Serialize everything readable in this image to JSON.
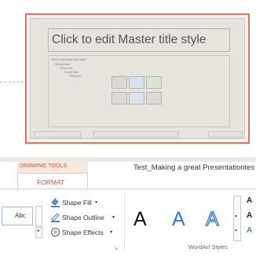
{
  "slide": {
    "title_placeholder": "Click to edit Master title style",
    "levels": [
      "Click to edit Master text styles",
      "Second level",
      "Third level",
      "Fourth level",
      "Fifth level"
    ],
    "footer": [
      "",
      "",
      ""
    ]
  },
  "contextual": {
    "group_label": "DRAWING TOOLS",
    "tab_label": "FORMAT",
    "accent": "#d0552c"
  },
  "document": {
    "title": "Test_Making a great Presentationtes"
  },
  "ribbon": {
    "style_sample": "Abc",
    "shape_fill": "Shape Fill",
    "shape_outline": "Shape Outline",
    "shape_effects": "Shape Effects",
    "dropdown_glyph": "▾",
    "wordart_letters": [
      "A",
      "A",
      "A"
    ],
    "wordart_group": "WordArt Styles",
    "launcher_glyph": "↘",
    "mini_letters": [
      "A",
      "A",
      "A"
    ]
  }
}
